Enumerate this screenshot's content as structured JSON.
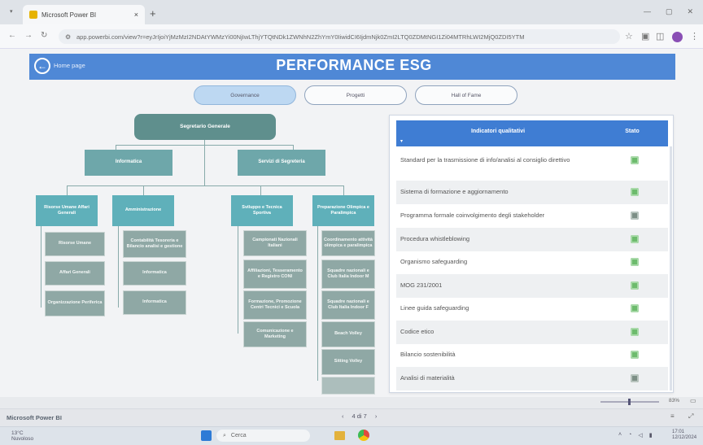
{
  "browser": {
    "tab_title": "Microsoft Power BI",
    "tab_close": "×",
    "new_tab": "+",
    "url": "app.powerbi.com/view?r=eyJrIjoiYjMzMzI2NDAtYWMzYi00NjIwLThjYTQtNDk1ZWNhN2ZhYmY0IiwidCI6IjdmNjk0ZmI2LTQ0ZDMtNGI1Zi04MTRhLWI2MjQ0ZDI5YTM",
    "window_controls": [
      "—",
      "▢",
      "✕"
    ]
  },
  "header": {
    "home_label": "Home page",
    "title": "PERFORMANCE ESG"
  },
  "nav": {
    "tabs": [
      {
        "label": "Governance",
        "active": true
      },
      {
        "label": "Progetti",
        "active": false
      },
      {
        "label": "Hall of Fame",
        "active": false
      }
    ]
  },
  "org_chart": {
    "top": "Segretario Generale",
    "level1": [
      "Informatica",
      "Servizi di Segreteria"
    ],
    "level2": [
      "Risorse Umane Affari Generali",
      "Amministrazione",
      "Sviluppo e Tecnica Sportiva",
      "Preparazione Olimpica e Paralimpica"
    ],
    "col_risorse": [
      "Risorse Umane",
      "Affari Generali",
      "Organizzazione Periferica"
    ],
    "col_amministrazione": [
      "Contabilità Tesoreria e Bilancio analisi e gestione",
      "Informatica",
      "Informatica"
    ],
    "col_sviluppo": [
      "Campionati Nazionali Italiani",
      "Affiliazioni, Tesseramento e Registro CONI",
      "Formazione, Promozione Centri Tecnici e Scuola",
      "Comunicazione e Marketing"
    ],
    "col_preparazione": [
      "Coordinamento attività olimpica e paralimpica",
      "Squadre nazionali e Club Italia Indoor M",
      "Squadre nazionali e Club Italia Indoor F",
      "Beach Volley",
      "Sitting Volley",
      ""
    ]
  },
  "table": {
    "col1": "Indicatori qualitativi",
    "col2": "Stato",
    "sort_icon": "▾",
    "rows": [
      {
        "label": "Standard per la trasmissione di info/analisi al consiglio direttivo",
        "status_color": "#6dbb6d"
      },
      {
        "label": "Sistema di formazione e aggiornamento",
        "status_color": "#6dbb6d"
      },
      {
        "label": "Programma formale coinvolgimento degli stakeholder",
        "status_color": "#7d8f86"
      },
      {
        "label": "Procedura whistleblowing",
        "status_color": "#6dbb6d"
      },
      {
        "label": "Organismo safeguarding",
        "status_color": "#6dbb6d"
      },
      {
        "label": "MOG 231/2001",
        "status_color": "#6dbb6d"
      },
      {
        "label": "Linee guida safeguarding",
        "status_color": "#6dbb6d"
      },
      {
        "label": "Codice etico",
        "status_color": "#6dbb6d"
      },
      {
        "label": "Bilancio sostenibilità",
        "status_color": "#6dbb6d"
      },
      {
        "label": "Analisi di materialità",
        "status_color": "#7d8f86"
      }
    ]
  },
  "status": {
    "brand": "Microsoft Power BI",
    "pager": "4 di 7",
    "prev": "‹",
    "next": "›",
    "zoom": "83%"
  },
  "taskbar": {
    "weather_temp": "13°C",
    "weather_desc": "Nuvoloso",
    "search_placeholder": "Cerca",
    "time": "17:01",
    "date": "12/12/2024"
  }
}
